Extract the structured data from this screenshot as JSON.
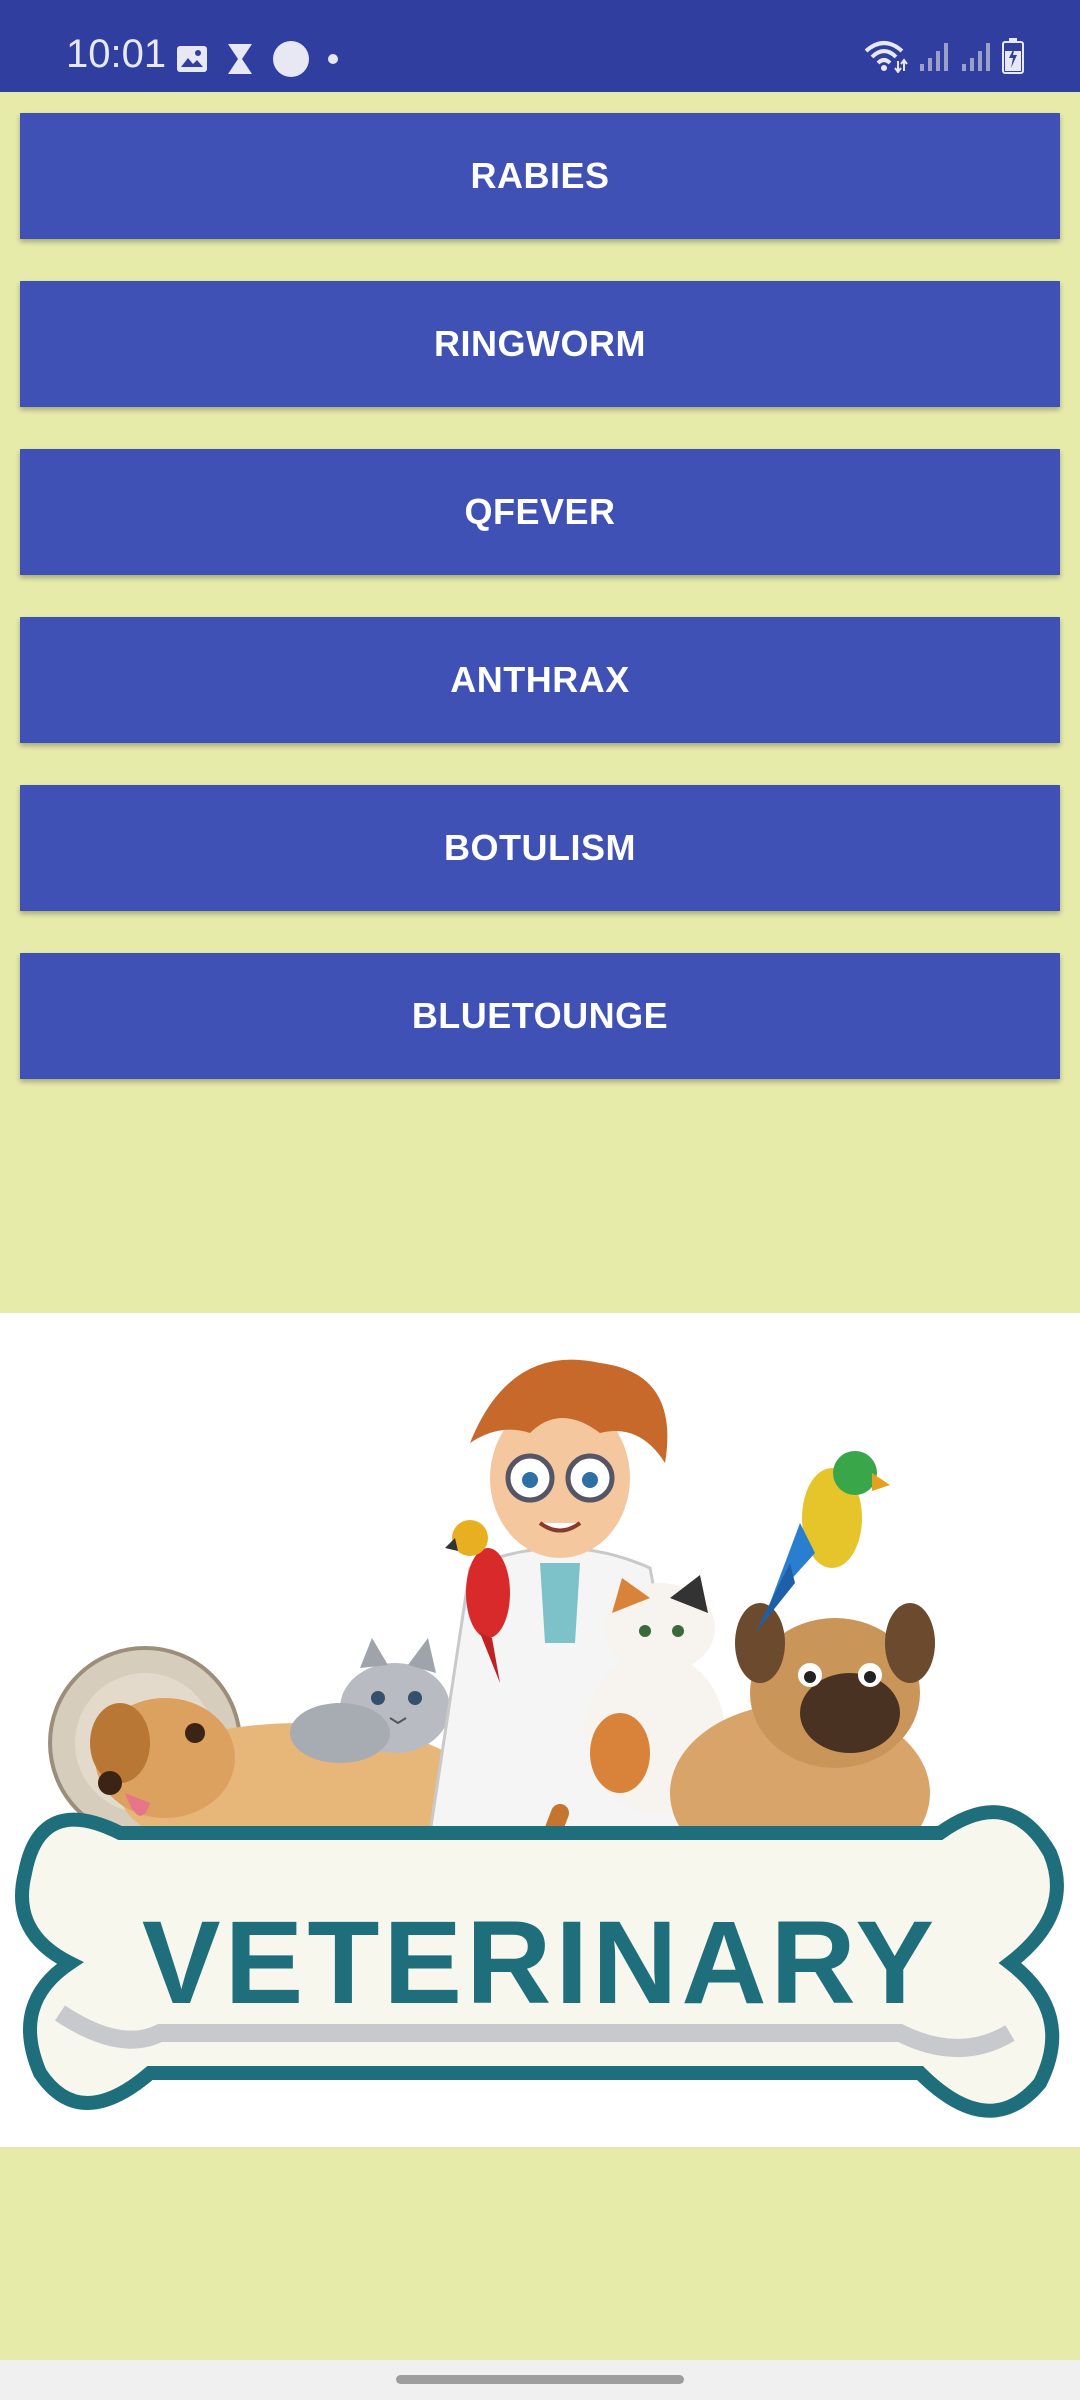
{
  "status_bar": {
    "time": "10:01",
    "left_icons": [
      "gallery-icon",
      "hourglass-icon",
      "circle-icon",
      "dot-icon"
    ],
    "right_icons": [
      "wifi-icon",
      "signal-icon",
      "signal-icon",
      "battery-charging-icon"
    ],
    "battery_level": 0.7
  },
  "buttons": [
    {
      "label": "RABIES"
    },
    {
      "label": "RINGWORM"
    },
    {
      "label": "QFEVER"
    },
    {
      "label": "ANTHRAX"
    },
    {
      "label": "BOTULISM"
    },
    {
      "label": "BLUETOUNGE"
    }
  ],
  "illustration": {
    "text": "VETERINARY"
  },
  "colors": {
    "status_bar": "#303f9f",
    "button": "#3f51b5",
    "background": "#e6ebaa",
    "logo_teal": "#1f6e7c"
  }
}
